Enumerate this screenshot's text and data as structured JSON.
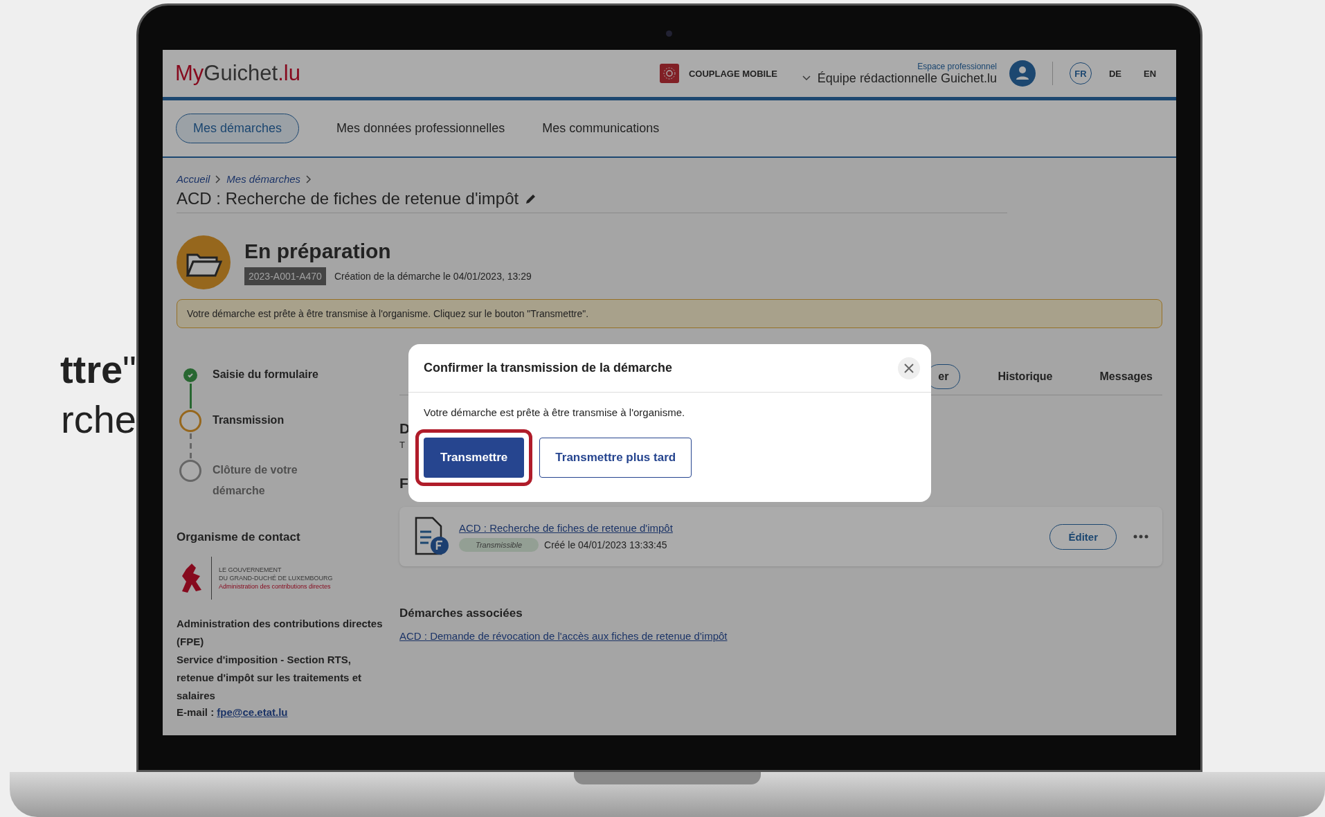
{
  "backdrop_text": [
    {
      "kind": "bold",
      "text": "**ttre**\""
    },
    {
      "kind": "plain",
      "text": "rche"
    }
  ],
  "header": {
    "logo": [
      {
        "text": "My",
        "accent": true
      },
      {
        "text": "Guichet",
        "accent": false
      },
      {
        "text": ".lu",
        "accent": true
      }
    ],
    "mobile_pairing": "COUPLAGE MOBILE",
    "space_label": "Espace professionnel",
    "account": "Équipe rédactionnelle Guichet.lu",
    "languages": [
      {
        "label": "FR",
        "selected": true
      },
      {
        "label": "DE",
        "selected": false
      },
      {
        "label": "EN",
        "selected": false
      }
    ]
  },
  "nav": [
    {
      "label": "Mes démarches",
      "selected": true
    },
    {
      "label": "Mes données professionnelles",
      "selected": false
    },
    {
      "label": "Mes communications",
      "selected": false
    }
  ],
  "breadcrumb": [
    "Accueil",
    "Mes démarches"
  ],
  "title": "ACD : Recherche de fiches de retenue d'impôt",
  "status": {
    "label": "En préparation",
    "reference": "2023-A001-A470",
    "created": "Création de la démarche le 04/01/2023, 13:29"
  },
  "alert": "Votre démarche est prête à être transmise à l'organisme. Cliquez sur le bouton \"Transmettre\".",
  "steps": [
    {
      "label": "Saisie du formulaire",
      "completed": true,
      "current": false
    },
    {
      "label": "Transmission",
      "completed": false,
      "current": true
    },
    {
      "label": "Clôture de votre démarche",
      "completed": false,
      "current": false
    }
  ],
  "contact": {
    "heading": "Organisme de contact",
    "logo_lines": [
      "LE GOUVERNEMENT",
      "DU GRAND-DUCHÉ DE LUXEMBOURG",
      "Administration des contributions directes"
    ],
    "address": [
      "Administration des contributions directes (FPE)",
      "Service d'imposition - Section RTS, retenue d'impôt sur les traitements et salaires"
    ],
    "email_label": "E-mail : ",
    "email": "fpe@ce.etat.lu"
  },
  "tabs": [
    {
      "label": "er",
      "selected": true
    },
    {
      "label": "Historique",
      "selected": false
    },
    {
      "label": "Messages",
      "selected": false
    }
  ],
  "covered_headings": [
    {
      "kind": "heading",
      "text": "D"
    },
    {
      "kind": "small",
      "text": "T"
    },
    {
      "kind": "heading",
      "text": "F"
    }
  ],
  "form_card": {
    "title": "ACD : Recherche de fiches de retenue d'impôt",
    "badge": "Transmissible",
    "created": "Créé le 04/01/2023 13:33:45",
    "edit": "Éditer"
  },
  "related": {
    "heading": "Démarches associées",
    "links": [
      "ACD : Demande de révocation de l'accès aux fiches de retenue d'impôt"
    ]
  },
  "modal": {
    "title": "Confirmer la transmission de la démarche",
    "text": "Votre démarche est prête à être transmise à l'organisme.",
    "primary": "Transmettre",
    "secondary": "Transmettre plus tard",
    "highlighted": true
  }
}
